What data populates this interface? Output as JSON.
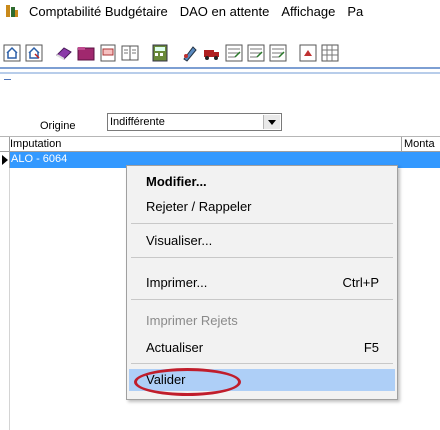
{
  "menubar": {
    "items": [
      "Comptabilité Budgétaire",
      "DAO en attente",
      "Affichage",
      "Pa"
    ]
  },
  "toolbar": {
    "icons": [
      "home-icon",
      "home-shortcut-icon",
      "eraser-icon",
      "folder-icon",
      "document-ab-icon",
      "book-icon",
      "calculator-icon",
      "user-pen-icon",
      "truck-icon",
      "form-icon",
      "form2-icon",
      "form3-icon",
      "export-icon",
      "grid-icon"
    ]
  },
  "filter": {
    "origine_label": "Origine",
    "origine_value": "Indifférente"
  },
  "grid": {
    "headers": [
      "Imputation",
      "Monta"
    ],
    "rows": [
      {
        "imputation": "ALO - 6064",
        "selected": true
      }
    ]
  },
  "context_menu": {
    "items": [
      {
        "label": "Modifier...",
        "shortcut": "",
        "bold": true
      },
      {
        "label": "Rejeter / Rappeler",
        "shortcut": ""
      },
      {
        "label": "Visualiser...",
        "shortcut": ""
      },
      {
        "label": "Imprimer...",
        "shortcut": "Ctrl+P"
      },
      {
        "label": "Imprimer Rejets",
        "shortcut": "",
        "disabled": true
      },
      {
        "label": "Actualiser",
        "shortcut": "F5"
      },
      {
        "label": "Valider",
        "shortcut": "",
        "hovered": true,
        "highlighted": true
      }
    ]
  },
  "colors": {
    "selection": "#3399ff",
    "menu_hover": "#aecff7",
    "annotation_ring": "#c01d2b"
  }
}
